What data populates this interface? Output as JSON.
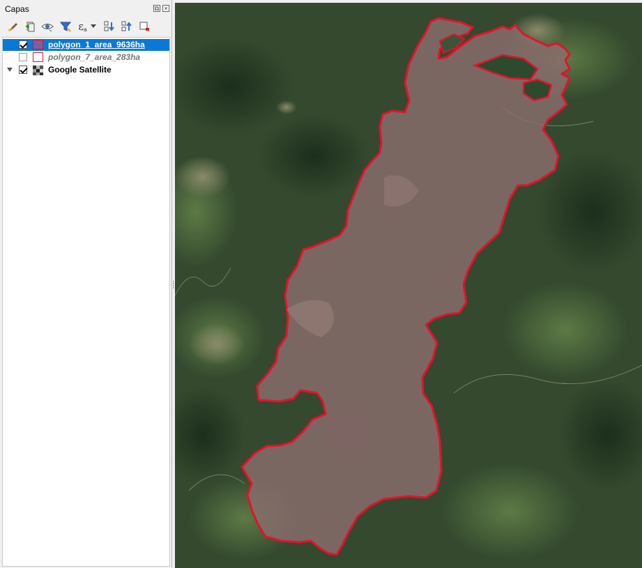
{
  "layers_panel": {
    "title": "Capas",
    "float_icon": "float-window-icon",
    "close_icon": "close-icon",
    "toolbar": [
      {
        "name": "style-brush-icon",
        "icon": "paintbrush"
      },
      {
        "name": "add-group-icon",
        "icon": "add-group"
      },
      {
        "name": "visibility-eye-icon",
        "icon": "eye"
      },
      {
        "name": "filter-funnel-icon",
        "icon": "funnel"
      },
      {
        "name": "expression-filter-icon",
        "icon": "epsilon"
      },
      {
        "name": "expand-all-icon",
        "icon": "expand"
      },
      {
        "name": "collapse-all-icon",
        "icon": "collapse"
      },
      {
        "name": "remove-layer-icon",
        "icon": "remove"
      }
    ],
    "expression_symbol": "ε",
    "expression_sub": "a",
    "layers": [
      {
        "name": "polygon_1_area_9636ha",
        "checked": true,
        "selected": true,
        "symbol_fill": "#7d5fa0",
        "symbol_border": "#d0182a"
      },
      {
        "name": "polygon_7_area_283ha",
        "checked": false,
        "selected": false,
        "symbol_fill": "#ffffff",
        "symbol_border": "#d0182a"
      },
      {
        "name": "Google Satellite",
        "checked": true,
        "selected": false,
        "expanded": true
      }
    ]
  },
  "map": {
    "basemap": "Google Satellite imagery",
    "polygon_outline_color": "#e8102a",
    "polygon_fill_color": "#8a6e6e"
  }
}
